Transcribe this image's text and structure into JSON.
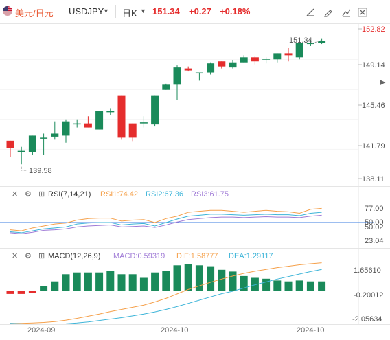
{
  "header": {
    "symbol_name": "美元/日元",
    "symbol_code": "USDJPY",
    "period": "日K",
    "price": "151.34",
    "change": "+0.27",
    "change_pct": "+0.18%",
    "tools": [
      "draw-line-icon",
      "pen-icon",
      "compare-icon",
      "close-icon"
    ]
  },
  "price_axis": {
    "labels": [
      "152.82",
      "149.14",
      "145.46",
      "141.79",
      "138.11"
    ],
    "last_price_tag": "151.34",
    "low_tag": "139.58"
  },
  "rsi": {
    "label": "RSI(7,14,21)",
    "rsi1": "RSI1:74.42",
    "rsi2": "RSI2:67.36",
    "rsi3": "RSI3:61.75",
    "axis": [
      "77.00",
      "50.00",
      "50.02",
      "23.04"
    ],
    "colors": {
      "rsi1": "#f5a04a",
      "rsi2": "#3cb4d8",
      "rsi3": "#9f7ad6"
    }
  },
  "macd": {
    "label": "MACD(12,26,9)",
    "macd": "MACD:0.59319",
    "dif": "DIF:1.58777",
    "dea": "DEA:1.29117",
    "axis": [
      "1.65610",
      "-0.20012",
      "-2.05634"
    ],
    "colors": {
      "macd": "#9f7ad6",
      "dif": "#f5a04a",
      "dea": "#3cb4d8"
    }
  },
  "x_axis": [
    "2024-09",
    "2024-10",
    "2024-10"
  ],
  "colors": {
    "up": "#1a8a5a",
    "down": "#e52d2d"
  },
  "chart_data": {
    "type": "candlestick",
    "title": "",
    "ylim": [
      138.11,
      152.82
    ],
    "candles": [
      {
        "o": 141.9,
        "h": 141.9,
        "l": 140.3,
        "c": 141.2
      },
      {
        "o": 140.8,
        "h": 141.3,
        "l": 139.58,
        "c": 140.9
      },
      {
        "o": 140.8,
        "h": 142.4,
        "l": 140.5,
        "c": 142.4
      },
      {
        "o": 142.2,
        "h": 142.6,
        "l": 140.5,
        "c": 142.2
      },
      {
        "o": 142.3,
        "h": 143.8,
        "l": 142.0,
        "c": 142.6
      },
      {
        "o": 142.4,
        "h": 144.0,
        "l": 141.7,
        "c": 143.8
      },
      {
        "o": 143.6,
        "h": 144.0,
        "l": 143.2,
        "c": 143.6
      },
      {
        "o": 143.6,
        "h": 144.3,
        "l": 143.2,
        "c": 143.2
      },
      {
        "o": 143.0,
        "h": 144.8,
        "l": 143.0,
        "c": 144.8
      },
      {
        "o": 144.8,
        "h": 145.1,
        "l": 144.4,
        "c": 144.8
      },
      {
        "o": 146.3,
        "h": 146.3,
        "l": 142.0,
        "c": 142.2
      },
      {
        "o": 143.6,
        "h": 143.6,
        "l": 141.8,
        "c": 142.2
      },
      {
        "o": 143.7,
        "h": 144.3,
        "l": 143.2,
        "c": 143.7
      },
      {
        "o": 143.5,
        "h": 146.3,
        "l": 143.3,
        "c": 146.3
      },
      {
        "o": 146.9,
        "h": 147.5,
        "l": 146.9,
        "c": 147.4
      },
      {
        "o": 147.4,
        "h": 149.3,
        "l": 145.9,
        "c": 149.1
      },
      {
        "o": 149.0,
        "h": 149.2,
        "l": 148.7,
        "c": 148.8
      },
      {
        "o": 148.6,
        "h": 148.6,
        "l": 147.8,
        "c": 148.6
      },
      {
        "o": 148.6,
        "h": 149.6,
        "l": 148.4,
        "c": 149.5
      },
      {
        "o": 149.7,
        "h": 149.7,
        "l": 149.0,
        "c": 149.2
      },
      {
        "o": 149.1,
        "h": 149.8,
        "l": 149.0,
        "c": 149.6
      },
      {
        "o": 149.6,
        "h": 150.3,
        "l": 149.6,
        "c": 150.1
      },
      {
        "o": 150.1,
        "h": 150.2,
        "l": 149.4,
        "c": 149.7
      },
      {
        "o": 149.9,
        "h": 150.1,
        "l": 149.5,
        "c": 149.9
      },
      {
        "o": 149.9,
        "h": 150.5,
        "l": 149.6,
        "c": 150.5
      },
      {
        "o": 150.5,
        "h": 151.0,
        "l": 149.7,
        "c": 150.3
      },
      {
        "o": 150.1,
        "h": 151.7,
        "l": 149.9,
        "c": 151.5
      },
      {
        "o": 151.4,
        "h": 151.8,
        "l": 151.2,
        "c": 151.5
      },
      {
        "o": 151.5,
        "h": 151.9,
        "l": 151.4,
        "c": 151.7
      }
    ],
    "macd_hist": [
      -0.15,
      -0.15,
      -0.05,
      0.3,
      0.55,
      0.95,
      1.05,
      1.05,
      1.05,
      1.15,
      0.95,
      0.95,
      0.75,
      1.05,
      1.15,
      1.45,
      1.5,
      1.45,
      1.4,
      1.2,
      1.1,
      0.85,
      0.75,
      0.7,
      0.6,
      0.55,
      0.6,
      0.55,
      0.55
    ]
  }
}
